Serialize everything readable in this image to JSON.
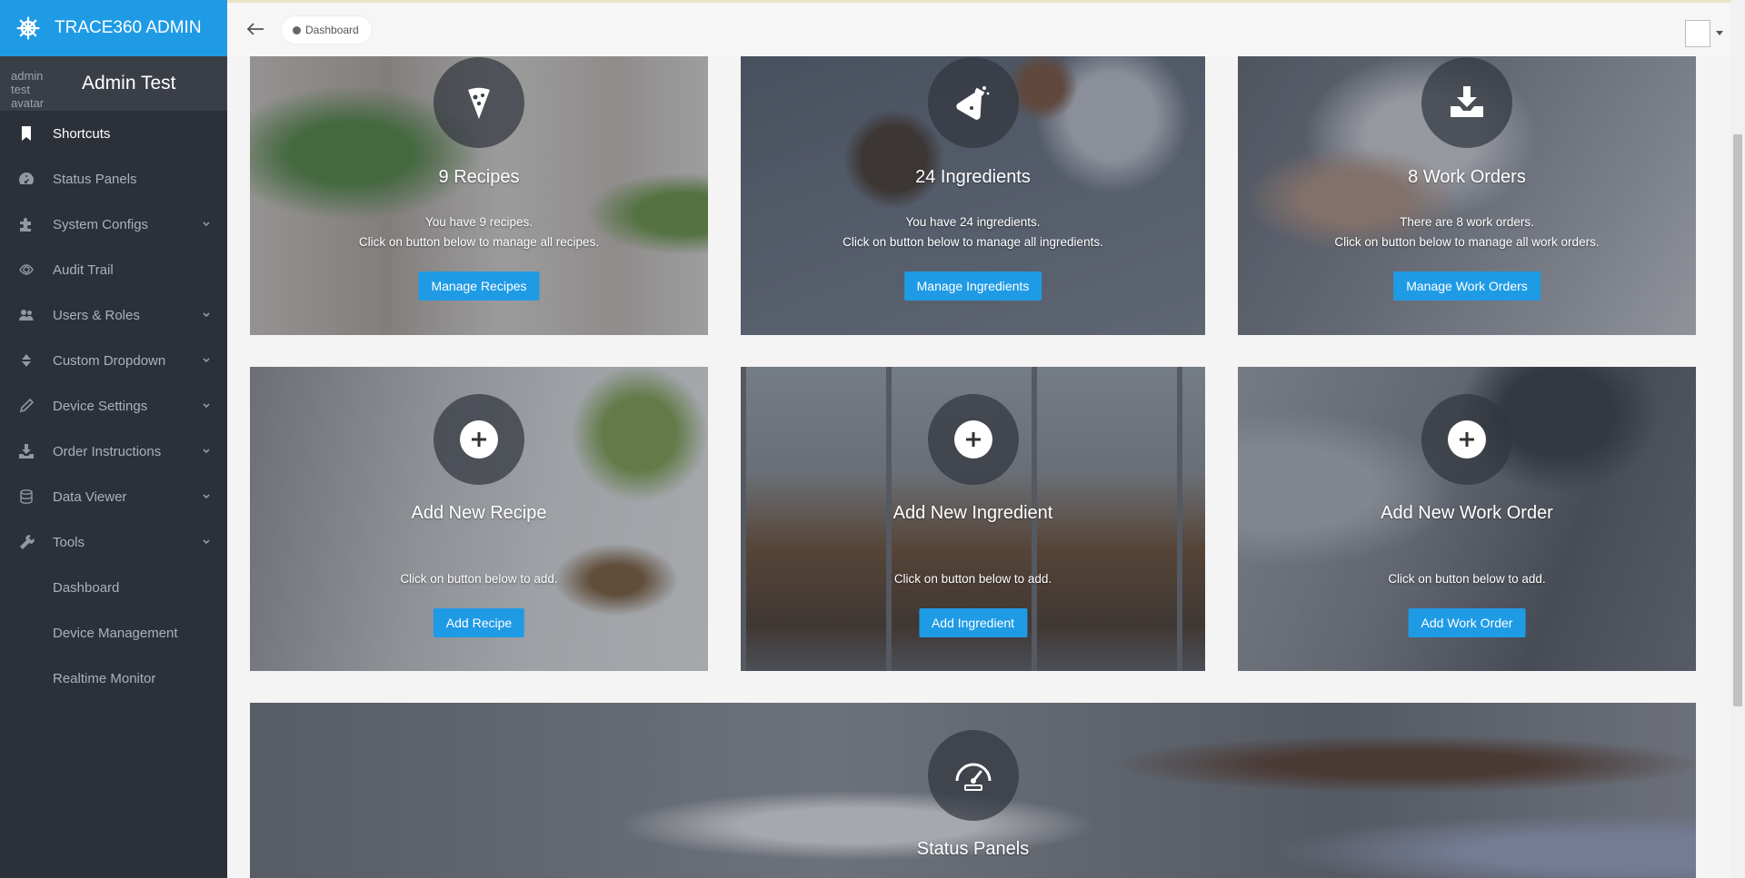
{
  "brand": {
    "title": "TRACE360 ADMIN"
  },
  "user": {
    "name": "Admin Test",
    "avatar_alt": "admin test avatar"
  },
  "sidebar": {
    "items": [
      {
        "label": "Shortcuts",
        "icon": "bookmark-icon",
        "active": true
      },
      {
        "label": "Status Panels",
        "icon": "dashboard-icon"
      },
      {
        "label": "System Configs",
        "icon": "puzzle-icon",
        "expandable": true
      },
      {
        "label": "Audit Trail",
        "icon": "eye-icon"
      },
      {
        "label": "Users & Roles",
        "icon": "users-icon",
        "expandable": true
      },
      {
        "label": "Custom Dropdown",
        "icon": "sort-icon",
        "expandable": true
      },
      {
        "label": "Device Settings",
        "icon": "pencil-icon",
        "expandable": true
      },
      {
        "label": "Order Instructions",
        "icon": "download-icon",
        "expandable": true
      },
      {
        "label": "Data Viewer",
        "icon": "database-icon",
        "expandable": true
      },
      {
        "label": "Tools",
        "icon": "tools-icon",
        "expandable": true
      }
    ],
    "subitems": [
      "Dashboard",
      "Device Management",
      "Realtime Monitor"
    ]
  },
  "breadcrumb": {
    "label": "Dashboard"
  },
  "cards": [
    {
      "title": "9 Recipes",
      "line1": "You have 9 recipes.",
      "line2": "Click on button below to manage all recipes.",
      "button": "Manage Recipes",
      "icon": "pizza-icon"
    },
    {
      "title": "24 Ingredients",
      "line1": "You have 24 ingredients.",
      "line2": "Click on button below to manage all ingredients.",
      "button": "Manage Ingredients",
      "icon": "flask-icon"
    },
    {
      "title": "8 Work Orders",
      "line1": "There are 8 work orders.",
      "line2": "Click on button below to manage all work orders.",
      "button": "Manage Work Orders",
      "icon": "download-tray-icon"
    },
    {
      "title": "Add New Recipe",
      "line1": "Click on button below to add.",
      "button": "Add Recipe",
      "icon": "plus-icon"
    },
    {
      "title": "Add New Ingredient",
      "line1": "Click on button below to add.",
      "button": "Add Ingredient",
      "icon": "plus-icon"
    },
    {
      "title": "Add New Work Order",
      "line1": "Click on button below to add.",
      "button": "Add Work Order",
      "icon": "plus-icon"
    },
    {
      "title": "Status Panels",
      "icon": "speedometer-icon"
    }
  ],
  "colors": {
    "brand": "#1f9be6",
    "sidebar": "#2c3038",
    "button": "#1f9be6"
  }
}
